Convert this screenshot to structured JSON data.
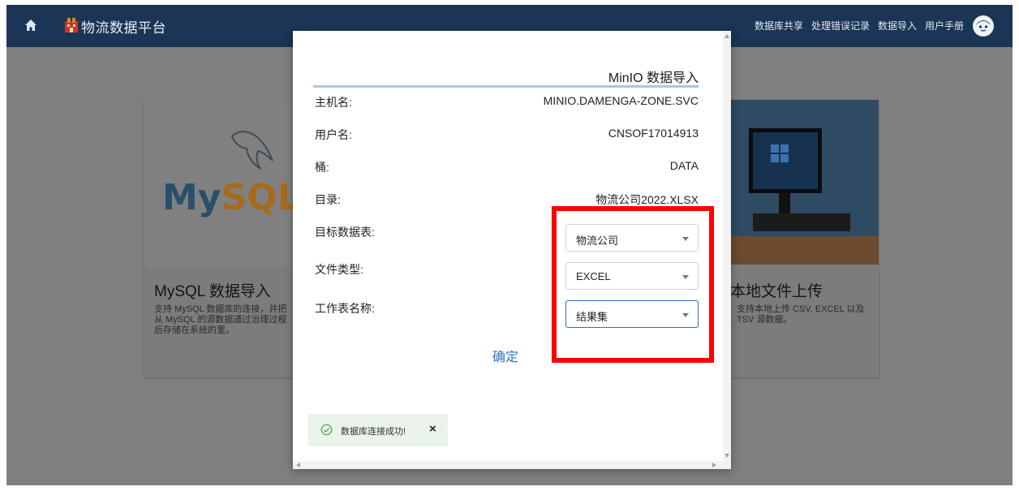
{
  "header": {
    "title": "物流数据平台",
    "home_icon": "home-icon",
    "logo_icon": "logo-icon",
    "nav": [
      "数据库共享",
      "处理错误记录",
      "数据导入",
      "用户手册"
    ],
    "avatar_icon": "user-avatar-icon"
  },
  "cards": {
    "mysql": {
      "logo_text_my": "My",
      "logo_text_sql": "SQL",
      "title": "MySQL 数据导入",
      "desc_lines": [
        "支持 MySQL 数据库的连接，并把",
        "从 MySQL 的源数据通过治理过程",
        "后存储在系统的里。"
      ]
    },
    "local": {
      "title": "本地文件上传",
      "desc_lines": [
        "支持本地上传 CSV, EXCEL 以及",
        "TSV 源数据。"
      ]
    }
  },
  "modal": {
    "title": "MinIO 数据导入",
    "fields": [
      {
        "label": "主机名:",
        "value": "MINIO.DAMENGA-ZONE.SVC"
      },
      {
        "label": "用户名:",
        "value": "CNSOF17014913"
      },
      {
        "label": "桶:",
        "value": "DATA"
      },
      {
        "label": "目录:",
        "value": "物流公司2022.XLSX"
      }
    ],
    "selects": [
      {
        "label": "目标数据表:",
        "value": "物流公司"
      },
      {
        "label": "文件类型:",
        "value": "EXCEL"
      },
      {
        "label": "工作表名称:",
        "value": "结果集"
      }
    ],
    "confirm_label": "确定"
  },
  "toast": {
    "message": "数据库连接成功!",
    "close": "×",
    "icon": "check-circle-icon"
  },
  "colors": {
    "topbar": "#1a3556",
    "overlay": "#7f7f7f",
    "accent": "#2f75c8",
    "highlight": "#ff0000",
    "toast_bg": "#ebf4ea"
  }
}
